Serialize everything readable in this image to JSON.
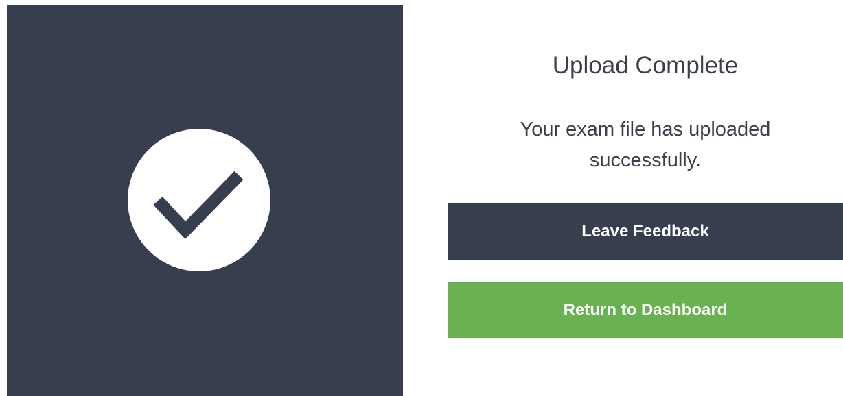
{
  "colors": {
    "panel": "#373e4e",
    "success_button": "#6ab151",
    "text": "#3a3f4c",
    "icon_circle": "#ffffff"
  },
  "status": {
    "icon": "check-icon"
  },
  "content": {
    "title": "Upload Complete",
    "message_line1": "Your exam file has uploaded",
    "message_line2": "successfully."
  },
  "actions": {
    "feedback_label": "Leave Feedback",
    "dashboard_label": "Return to Dashboard"
  }
}
